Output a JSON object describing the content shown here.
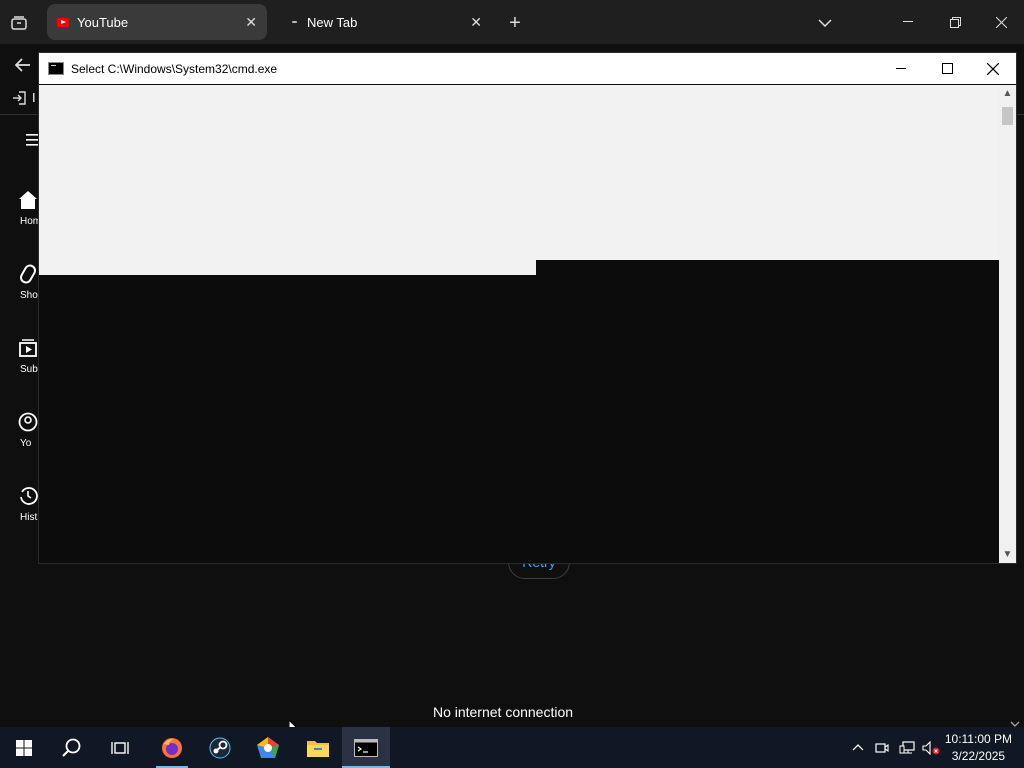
{
  "browser": {
    "tabs": [
      {
        "title": "YouTube"
      },
      {
        "title": "New Tab"
      }
    ],
    "nav_partial_text": "I"
  },
  "sidebar": {
    "items": [
      {
        "label": "Hom",
        "icon": "home-icon"
      },
      {
        "label": "Sho",
        "icon": "shorts-icon"
      },
      {
        "label": "Subscri",
        "icon": "subscriptions-icon"
      },
      {
        "label": "Yo",
        "icon": "you-icon"
      },
      {
        "label": "Hist",
        "icon": "history-icon"
      }
    ]
  },
  "cmd_window": {
    "title": "Select C:\\Windows\\System32\\cmd.exe"
  },
  "page": {
    "retry_label": "Retry",
    "status_text": "No internet connection"
  },
  "taskbar": {
    "apps": [
      "start",
      "search",
      "task-view",
      "firefox",
      "steam",
      "nimbus",
      "file-explorer",
      "command-prompt"
    ],
    "time": "10:11:00 PM",
    "date": "3/22/2025"
  },
  "colors": {
    "youtube_red": "#ff0000",
    "link_blue": "#3ea6ff",
    "taskbar_bg": "#101725"
  }
}
